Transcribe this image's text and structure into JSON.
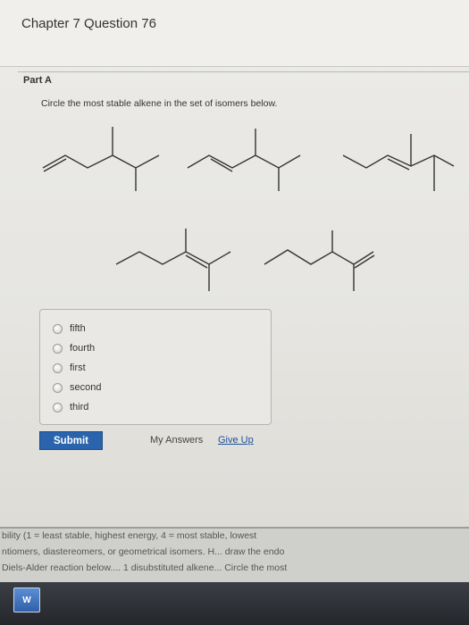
{
  "header": {
    "title": "Chapter 7 Question 76"
  },
  "part": {
    "label": "Part A",
    "prompt": "Circle the most stable alkene in the set of isomers below."
  },
  "choices": [
    "fifth",
    "fourth",
    "first",
    "second",
    "third"
  ],
  "actions": {
    "submit_label": "Submit",
    "my_answers_label": "My Answers",
    "give_up_label": "Give Up"
  },
  "background_window": {
    "lines": [
      "bility (1 = least stable, highest energy, 4 = most stable, lowest",
      "ntiomers, diastereomers, or geometrical isomers. H... draw the endo",
      "Diels-Alder reaction below.... 1 disubstituted alkene... Circle the most"
    ]
  },
  "taskbar": {
    "word_icon_label": "W"
  },
  "colors": {
    "submit_bg": "#2a64ad",
    "link": "#1e4f9a",
    "taskbar": "#2b2e33"
  }
}
